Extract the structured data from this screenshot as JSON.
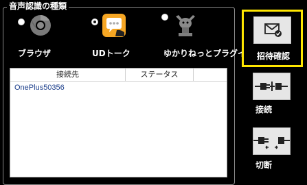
{
  "group": {
    "title": "音声認識の種類"
  },
  "engines": [
    {
      "label": "ブラウザ",
      "icon": "chrome-icon",
      "selected": false
    },
    {
      "label": "UDトーク",
      "icon": "chat-bubble-icon",
      "selected": true
    },
    {
      "label": "ゆかりねっとプラグイン",
      "icon": "plugin-icon",
      "selected": false
    }
  ],
  "table": {
    "columns": [
      "接続先",
      "ステータス"
    ],
    "rows": [
      {
        "name": "OnePlus50356",
        "status": ""
      }
    ]
  },
  "buttons": {
    "invite": "招待確認",
    "connect": "接続",
    "disconnect": "切断"
  },
  "colors": {
    "highlight": "#ffe600",
    "udtalk_orange": "#f6a623",
    "background": "#000000"
  }
}
